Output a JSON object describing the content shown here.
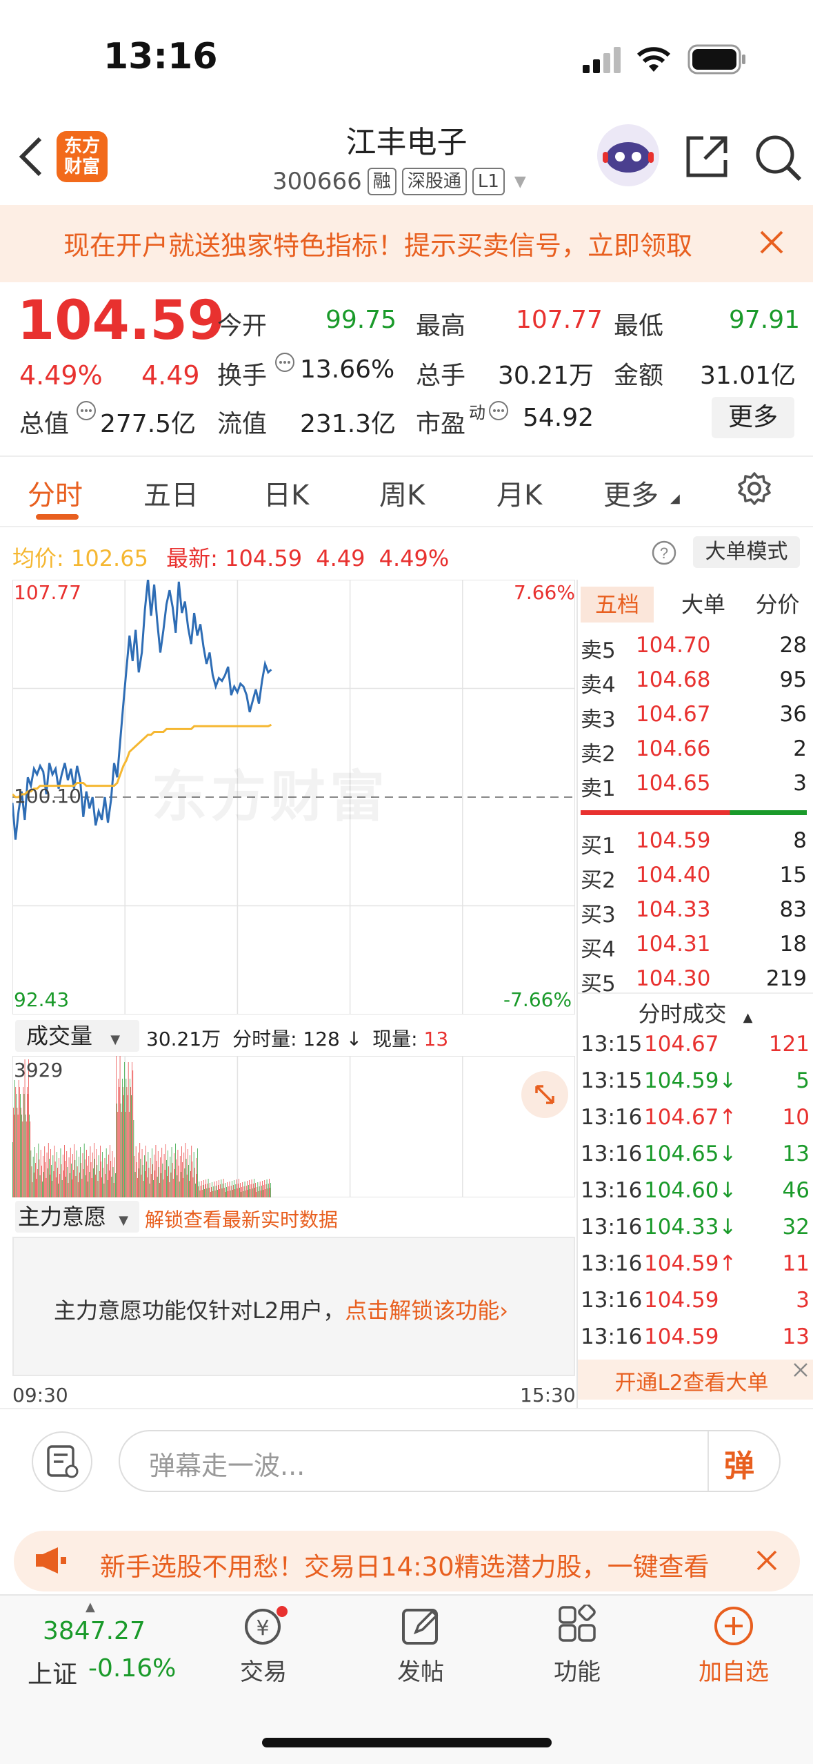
{
  "status": {
    "time": "13:16"
  },
  "header": {
    "logo_line1": "东方",
    "logo_line2": "财富",
    "title": "江丰电子",
    "code": "300666",
    "tags": [
      "融",
      "深股通",
      "L1"
    ]
  },
  "banner": {
    "text": "现在开户就送独家特色指标！提示买卖信号，立即领取"
  },
  "quote": {
    "price": "104.59",
    "pct": "4.49%",
    "chg": "4.49",
    "labels": {
      "open": "今开",
      "high": "最高",
      "low": "最低",
      "turnover": "换手",
      "volume": "总手",
      "amount": "金额",
      "mktcap": "总值",
      "float": "流值",
      "pe": "市盈",
      "pe_sup": "动"
    },
    "open": "99.75",
    "high": "107.77",
    "low": "97.91",
    "turnover": "13.66%",
    "volume": "30.21万",
    "amount": "31.01亿",
    "mktcap": "277.5亿",
    "float": "231.3亿",
    "pe": "54.92",
    "more": "更多"
  },
  "tabs": [
    "分时",
    "五日",
    "日K",
    "周K",
    "月K",
    "更多"
  ],
  "chart_info": {
    "avg_label": "均价:",
    "avg": "102.65",
    "latest_label": "最新:",
    "latest": "104.59",
    "chg": "4.49",
    "pct": "4.49%",
    "big_order_mode": "大单模式",
    "watermark": "东方财富"
  },
  "chart_data": {
    "type": "line",
    "y_top": "107.77",
    "y_mid": "100.10",
    "y_bottom": "92.43",
    "pct_top": "7.66%",
    "pct_bottom": "-7.66%",
    "x_start": "09:30",
    "x_end": "15:30",
    "ylim": [
      92.43,
      107.77
    ],
    "series": [
      {
        "values": [
          99.9,
          98.6,
          99.6,
          100.3,
          99.3,
          100.8,
          100.5,
          101.1,
          100.9,
          101.2,
          101.0,
          100.2,
          101.3,
          100.9,
          101.1,
          100.4,
          100.9,
          101.3,
          100.7,
          101.1,
          100.4,
          101.2,
          100.7,
          99.4,
          100.3,
          99.7,
          100.1,
          99.1,
          99.6,
          99.3,
          100.1,
          99.2,
          100.0,
          101.3,
          100.8,
          102.1,
          103.4,
          104.6,
          105.8,
          104.9,
          106.0,
          104.5,
          105.2,
          106.7,
          107.8,
          106.5,
          107.6,
          106.3,
          105.2,
          106.0,
          106.9,
          107.4,
          106.8,
          105.9,
          107.7,
          106.6,
          107.0,
          106.1,
          105.5,
          106.6,
          105.8,
          106.2,
          105.4,
          104.8,
          105.2,
          104.4,
          104.0,
          104.3,
          104.2,
          104.4,
          104.7,
          103.7,
          104.0,
          103.8,
          104.1,
          104.0,
          103.7,
          103.1,
          103.5,
          103.9,
          103.4,
          104.2,
          104.8,
          104.5,
          104.6
        ]
      },
      {
        "values": [
          100.2,
          100.1,
          100.1,
          100.2,
          100.2,
          100.3,
          100.3,
          100.4,
          100.4,
          100.5,
          100.5,
          100.5,
          100.5,
          100.5,
          100.5,
          100.5,
          100.5,
          100.5,
          100.5,
          100.5,
          100.5,
          100.6,
          100.6,
          100.6,
          100.5,
          100.5,
          100.5,
          100.5,
          100.5,
          100.5,
          100.5,
          100.5,
          100.5,
          100.5,
          100.6,
          100.9,
          101.2,
          101.4,
          101.7,
          101.8,
          101.9,
          102.0,
          102.1,
          102.2,
          102.3,
          102.3,
          102.4,
          102.4,
          102.4,
          102.4,
          102.5,
          102.5,
          102.5,
          102.5,
          102.5,
          102.5,
          102.5,
          102.5,
          102.5,
          102.6,
          102.6,
          102.6,
          102.6,
          102.6,
          102.6,
          102.6,
          102.6,
          102.6,
          102.6,
          102.6,
          102.6,
          102.6,
          102.6,
          102.6,
          102.6,
          102.6,
          102.6,
          102.6,
          102.6,
          102.6,
          102.6,
          102.6,
          102.6,
          102.6,
          102.65
        ]
      }
    ]
  },
  "volume": {
    "select": "成交量",
    "total": "30.21万",
    "period_label": "分时量:",
    "period": "128",
    "arrow": "↓",
    "now_label": "现量:",
    "now": "13",
    "max": "3929"
  },
  "main_force": {
    "select": "主力意愿",
    "unlock_link": "解锁查看最新实时数据",
    "notice": "主力意愿功能仅针对L2用户，",
    "notice_link": "点击解锁该功能",
    "notice_chevron": "›"
  },
  "orderbook": {
    "tabs": [
      "五档",
      "大单",
      "分价"
    ],
    "asks": [
      {
        "k": "卖5",
        "p": "104.70",
        "v": "28"
      },
      {
        "k": "卖4",
        "p": "104.68",
        "v": "95"
      },
      {
        "k": "卖3",
        "p": "104.67",
        "v": "36"
      },
      {
        "k": "卖2",
        "p": "104.66",
        "v": "2"
      },
      {
        "k": "卖1",
        "p": "104.65",
        "v": "3"
      }
    ],
    "bids": [
      {
        "k": "买1",
        "p": "104.59",
        "v": "8"
      },
      {
        "k": "买2",
        "p": "104.40",
        "v": "15"
      },
      {
        "k": "买3",
        "p": "104.33",
        "v": "83"
      },
      {
        "k": "买4",
        "p": "104.31",
        "v": "18"
      },
      {
        "k": "买5",
        "p": "104.30",
        "v": "219"
      }
    ]
  },
  "trades": {
    "title": "分时成交",
    "rows": [
      {
        "t": "13:15",
        "p": "104.67",
        "a": "",
        "v": "121",
        "c": "red"
      },
      {
        "t": "13:15",
        "p": "104.59",
        "a": "↓",
        "v": "5",
        "c": "green"
      },
      {
        "t": "13:16",
        "p": "104.67",
        "a": "↑",
        "v": "10",
        "c": "red"
      },
      {
        "t": "13:16",
        "p": "104.65",
        "a": "↓",
        "v": "13",
        "c": "green"
      },
      {
        "t": "13:16",
        "p": "104.60",
        "a": "↓",
        "v": "46",
        "c": "green"
      },
      {
        "t": "13:16",
        "p": "104.33",
        "a": "↓",
        "v": "32",
        "c": "green"
      },
      {
        "t": "13:16",
        "p": "104.59",
        "a": "↑",
        "v": "11",
        "c": "red"
      },
      {
        "t": "13:16",
        "p": "104.59",
        "a": "",
        "v": "3",
        "c": "red"
      },
      {
        "t": "13:16",
        "p": "104.59",
        "a": "",
        "v": "13",
        "c": "red"
      }
    ],
    "l2_link": "开通L2查看大单"
  },
  "comment": {
    "placeholder": "弹幕走一波...",
    "btn": "弹"
  },
  "promo": {
    "text": "新手选股不用愁！交易日14:30精选潜力股，一键查看"
  },
  "nav": {
    "index_value": "3847.27",
    "index_name": "上证",
    "index_pct": "-0.16%",
    "items": [
      "交易",
      "发帖",
      "功能",
      "加自选"
    ]
  },
  "colors": {
    "accent": "#e85f1f",
    "up": "#e8312f",
    "down": "#1a9a2a",
    "price_line": "#2e6db5",
    "avg_line": "#f5b731"
  }
}
